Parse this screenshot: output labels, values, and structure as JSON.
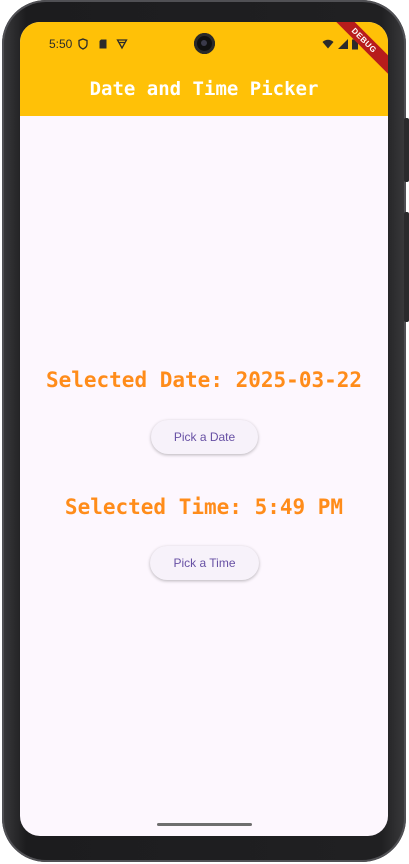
{
  "status_bar": {
    "time": "5:50",
    "icons": [
      "shield-icon",
      "sd-card-icon",
      "download-icon",
      "wifi-icon",
      "signal-icon",
      "battery-icon"
    ]
  },
  "debug_banner": "DEBUG",
  "app_bar": {
    "title": "Date and Time Picker",
    "color": "#ffc107"
  },
  "date": {
    "label": "Selected Date: 2025-03-22",
    "button_label": "Pick a Date"
  },
  "time": {
    "label": "Selected Time: 5:49 PM",
    "button_label": "Pick a Time"
  },
  "colors": {
    "accent_text": "#ff8c1a",
    "button_text": "#6750a4",
    "background": "#fdf7fe"
  }
}
